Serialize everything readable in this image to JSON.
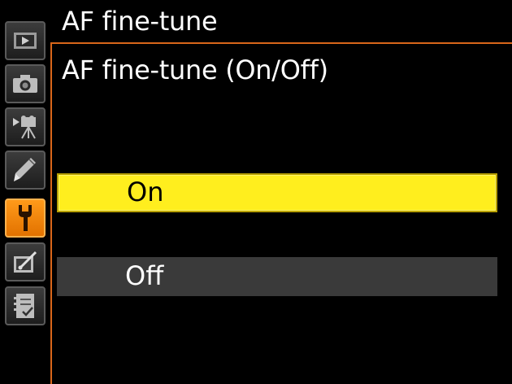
{
  "header": {
    "title": "AF fine-tune"
  },
  "page": {
    "subtitle": "AF fine-tune (On/Off)"
  },
  "options": [
    {
      "label": "On",
      "selected": true
    },
    {
      "label": "Off",
      "selected": false
    }
  ],
  "sidebar": {
    "tabs": [
      {
        "icon": "playback-icon",
        "active": false
      },
      {
        "icon": "camera-icon",
        "active": false
      },
      {
        "icon": "movie-icon",
        "active": false
      },
      {
        "icon": "pencil-icon",
        "active": false
      },
      {
        "icon": "wrench-icon",
        "active": true
      },
      {
        "icon": "retouch-icon",
        "active": false
      },
      {
        "icon": "my-menu-icon",
        "active": false
      }
    ]
  },
  "colors": {
    "accent": "#d9661a",
    "selection": "#ffee1e",
    "active_tab": "#ff9a1a",
    "unselected_row": "#3a3a3a"
  }
}
